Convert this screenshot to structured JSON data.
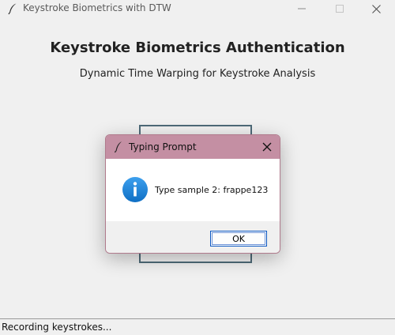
{
  "window": {
    "title": "Keystroke Biometrics with DTW",
    "app_icon": "feather-icon",
    "controls": [
      "minimize-icon",
      "maximize-icon",
      "close-icon"
    ]
  },
  "main": {
    "title": "Keystroke Biometrics Authentication",
    "subtitle": "Dynamic Time Warping for Keystroke Analysis"
  },
  "dialog": {
    "title": "Typing Prompt",
    "icon": "info-icon",
    "message": "Type sample 2: frappe123",
    "ok_label": "OK",
    "titlebar_color": "#c48fa3",
    "info_color": "#1a82d6"
  },
  "status": {
    "text": "Recording keystrokes..."
  }
}
